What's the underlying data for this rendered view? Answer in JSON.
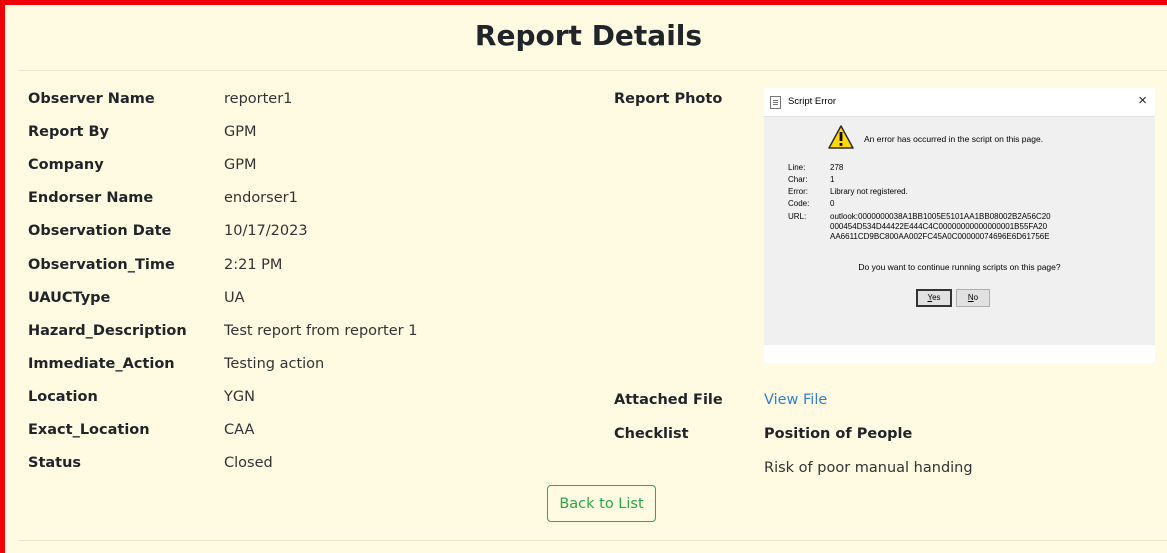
{
  "page": {
    "title": "Report Details"
  },
  "fields": [
    {
      "label": "Observer Name",
      "value": "reporter1"
    },
    {
      "label": "Report By",
      "value": "GPM"
    },
    {
      "label": "Company",
      "value": "GPM"
    },
    {
      "label": "Endorser Name",
      "value": "endorser1"
    },
    {
      "label": "Observation Date",
      "value": "10/17/2023"
    },
    {
      "label": "Observation_Time",
      "value": "2:21 PM"
    },
    {
      "label": "UAUCType",
      "value": "UA"
    },
    {
      "label": "Hazard_Description",
      "value": "Test report from reporter 1"
    },
    {
      "label": "Immediate_Action",
      "value": "Testing action"
    },
    {
      "label": "Location",
      "value": "YGN"
    },
    {
      "label": "Exact_Location",
      "value": "CAA"
    },
    {
      "label": "Status",
      "value": "Closed"
    }
  ],
  "photo": {
    "label": "Report Photo",
    "dialog": {
      "title": "Script Error",
      "close": "×",
      "message": "An error has occurred in the script on this page.",
      "line_key": "Line:",
      "line_val": "278",
      "char_key": "Char:",
      "char_val": "1",
      "error_key": "Error:",
      "error_val": "Library not registered.",
      "code_key": "Code:",
      "code_val": "0",
      "url_key": "URL:",
      "url_lines": [
        "outlook:0000000038A1BB1005E5101AA1BB08002B2A56C20",
        "000454D534D44422E444C4C00000000000000001B55FA20",
        "AA6611CD9BC800AA002FC45A0C00000074696E6D61756E"
      ],
      "question": "Do you want to continue running scripts on this page?",
      "yes_rest": "es",
      "yes_key": "Y",
      "no_rest": "o",
      "no_key": "N"
    }
  },
  "attached": {
    "label": "Attached File",
    "link": "View File"
  },
  "checklist": {
    "label": "Checklist",
    "heading": "Position of People",
    "item": "Risk of poor manual handing"
  },
  "actions": {
    "back": "Back to List"
  },
  "colors": {
    "background": "#fffbe2",
    "frame": "#ee0000",
    "link": "#2f7fd6",
    "success": "#28a745"
  }
}
